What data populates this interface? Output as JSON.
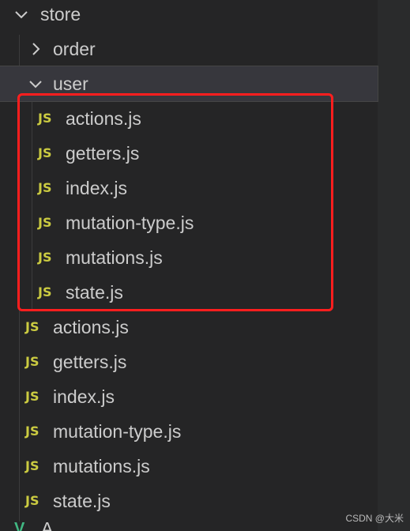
{
  "tree": {
    "store": {
      "label": "store",
      "icon": "chevron-down-icon"
    },
    "order": {
      "label": "order",
      "icon": "chevron-right-icon"
    },
    "user": {
      "label": "user",
      "icon": "chevron-down-icon"
    },
    "user_files": [
      {
        "icon_text": "JS",
        "label": "actions.js"
      },
      {
        "icon_text": "JS",
        "label": "getters.js"
      },
      {
        "icon_text": "JS",
        "label": "index.js"
      },
      {
        "icon_text": "JS",
        "label": "mutation-type.js"
      },
      {
        "icon_text": "JS",
        "label": "mutations.js"
      },
      {
        "icon_text": "JS",
        "label": "state.js"
      }
    ],
    "store_files": [
      {
        "icon_text": "JS",
        "label": "actions.js"
      },
      {
        "icon_text": "JS",
        "label": "getters.js"
      },
      {
        "icon_text": "JS",
        "label": "index.js"
      },
      {
        "icon_text": "JS",
        "label": "mutation-type.js"
      },
      {
        "icon_text": "JS",
        "label": "mutations.js"
      },
      {
        "icon_text": "JS",
        "label": "state.js"
      }
    ],
    "partial_item": {
      "icon_text": "V",
      "label": "A"
    }
  },
  "watermark": "CSDN @大米",
  "colors": {
    "background": "#252526",
    "text": "#cccccc",
    "js_icon": "#cbcb41",
    "highlight_box": "#ff1e1e",
    "vue_icon": "#41b883"
  }
}
